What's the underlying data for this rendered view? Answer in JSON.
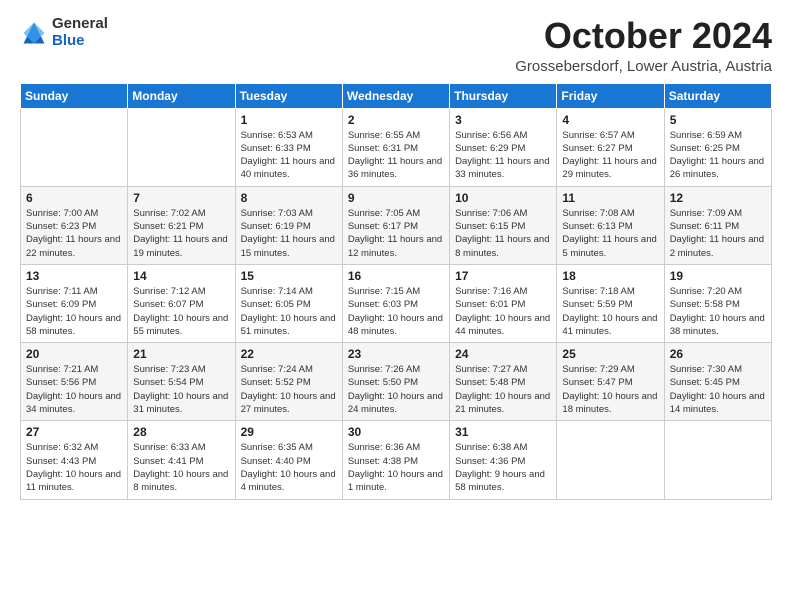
{
  "logo": {
    "general": "General",
    "blue": "Blue"
  },
  "title": "October 2024",
  "location": "Grossebersdorf, Lower Austria, Austria",
  "days_of_week": [
    "Sunday",
    "Monday",
    "Tuesday",
    "Wednesday",
    "Thursday",
    "Friday",
    "Saturday"
  ],
  "weeks": [
    [
      {
        "day": "",
        "info": ""
      },
      {
        "day": "",
        "info": ""
      },
      {
        "day": "1",
        "info": "Sunrise: 6:53 AM\nSunset: 6:33 PM\nDaylight: 11 hours and 40 minutes."
      },
      {
        "day": "2",
        "info": "Sunrise: 6:55 AM\nSunset: 6:31 PM\nDaylight: 11 hours and 36 minutes."
      },
      {
        "day": "3",
        "info": "Sunrise: 6:56 AM\nSunset: 6:29 PM\nDaylight: 11 hours and 33 minutes."
      },
      {
        "day": "4",
        "info": "Sunrise: 6:57 AM\nSunset: 6:27 PM\nDaylight: 11 hours and 29 minutes."
      },
      {
        "day": "5",
        "info": "Sunrise: 6:59 AM\nSunset: 6:25 PM\nDaylight: 11 hours and 26 minutes."
      }
    ],
    [
      {
        "day": "6",
        "info": "Sunrise: 7:00 AM\nSunset: 6:23 PM\nDaylight: 11 hours and 22 minutes."
      },
      {
        "day": "7",
        "info": "Sunrise: 7:02 AM\nSunset: 6:21 PM\nDaylight: 11 hours and 19 minutes."
      },
      {
        "day": "8",
        "info": "Sunrise: 7:03 AM\nSunset: 6:19 PM\nDaylight: 11 hours and 15 minutes."
      },
      {
        "day": "9",
        "info": "Sunrise: 7:05 AM\nSunset: 6:17 PM\nDaylight: 11 hours and 12 minutes."
      },
      {
        "day": "10",
        "info": "Sunrise: 7:06 AM\nSunset: 6:15 PM\nDaylight: 11 hours and 8 minutes."
      },
      {
        "day": "11",
        "info": "Sunrise: 7:08 AM\nSunset: 6:13 PM\nDaylight: 11 hours and 5 minutes."
      },
      {
        "day": "12",
        "info": "Sunrise: 7:09 AM\nSunset: 6:11 PM\nDaylight: 11 hours and 2 minutes."
      }
    ],
    [
      {
        "day": "13",
        "info": "Sunrise: 7:11 AM\nSunset: 6:09 PM\nDaylight: 10 hours and 58 minutes."
      },
      {
        "day": "14",
        "info": "Sunrise: 7:12 AM\nSunset: 6:07 PM\nDaylight: 10 hours and 55 minutes."
      },
      {
        "day": "15",
        "info": "Sunrise: 7:14 AM\nSunset: 6:05 PM\nDaylight: 10 hours and 51 minutes."
      },
      {
        "day": "16",
        "info": "Sunrise: 7:15 AM\nSunset: 6:03 PM\nDaylight: 10 hours and 48 minutes."
      },
      {
        "day": "17",
        "info": "Sunrise: 7:16 AM\nSunset: 6:01 PM\nDaylight: 10 hours and 44 minutes."
      },
      {
        "day": "18",
        "info": "Sunrise: 7:18 AM\nSunset: 5:59 PM\nDaylight: 10 hours and 41 minutes."
      },
      {
        "day": "19",
        "info": "Sunrise: 7:20 AM\nSunset: 5:58 PM\nDaylight: 10 hours and 38 minutes."
      }
    ],
    [
      {
        "day": "20",
        "info": "Sunrise: 7:21 AM\nSunset: 5:56 PM\nDaylight: 10 hours and 34 minutes."
      },
      {
        "day": "21",
        "info": "Sunrise: 7:23 AM\nSunset: 5:54 PM\nDaylight: 10 hours and 31 minutes."
      },
      {
        "day": "22",
        "info": "Sunrise: 7:24 AM\nSunset: 5:52 PM\nDaylight: 10 hours and 27 minutes."
      },
      {
        "day": "23",
        "info": "Sunrise: 7:26 AM\nSunset: 5:50 PM\nDaylight: 10 hours and 24 minutes."
      },
      {
        "day": "24",
        "info": "Sunrise: 7:27 AM\nSunset: 5:48 PM\nDaylight: 10 hours and 21 minutes."
      },
      {
        "day": "25",
        "info": "Sunrise: 7:29 AM\nSunset: 5:47 PM\nDaylight: 10 hours and 18 minutes."
      },
      {
        "day": "26",
        "info": "Sunrise: 7:30 AM\nSunset: 5:45 PM\nDaylight: 10 hours and 14 minutes."
      }
    ],
    [
      {
        "day": "27",
        "info": "Sunrise: 6:32 AM\nSunset: 4:43 PM\nDaylight: 10 hours and 11 minutes."
      },
      {
        "day": "28",
        "info": "Sunrise: 6:33 AM\nSunset: 4:41 PM\nDaylight: 10 hours and 8 minutes."
      },
      {
        "day": "29",
        "info": "Sunrise: 6:35 AM\nSunset: 4:40 PM\nDaylight: 10 hours and 4 minutes."
      },
      {
        "day": "30",
        "info": "Sunrise: 6:36 AM\nSunset: 4:38 PM\nDaylight: 10 hours and 1 minute."
      },
      {
        "day": "31",
        "info": "Sunrise: 6:38 AM\nSunset: 4:36 PM\nDaylight: 9 hours and 58 minutes."
      },
      {
        "day": "",
        "info": ""
      },
      {
        "day": "",
        "info": ""
      }
    ]
  ]
}
